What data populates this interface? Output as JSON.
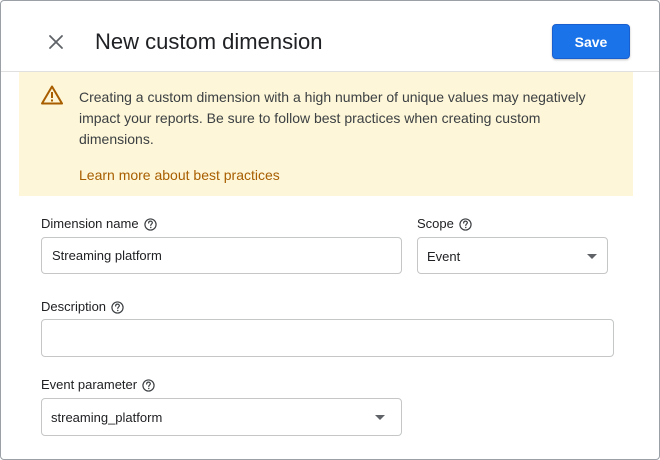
{
  "dialog": {
    "title": "New custom dimension",
    "close_icon": "close-icon",
    "save_label": "Save"
  },
  "banner": {
    "icon": "warning-icon",
    "text": "Creating a custom dimension with a high number of unique values may negatively impact your reports. Be sure to follow best practices when creating custom dimensions.",
    "link": "Learn more about best practices"
  },
  "form": {
    "dimension_name": {
      "label": "Dimension name",
      "value": "Streaming platform"
    },
    "scope": {
      "label": "Scope",
      "value": "Event"
    },
    "description": {
      "label": "Description",
      "value": ""
    },
    "event_parameter": {
      "label": "Event parameter",
      "value": "streaming_platform"
    }
  },
  "colors": {
    "accent": "#1a73e8",
    "banner_bg": "#fdf6d8",
    "link": "#a85e00"
  }
}
